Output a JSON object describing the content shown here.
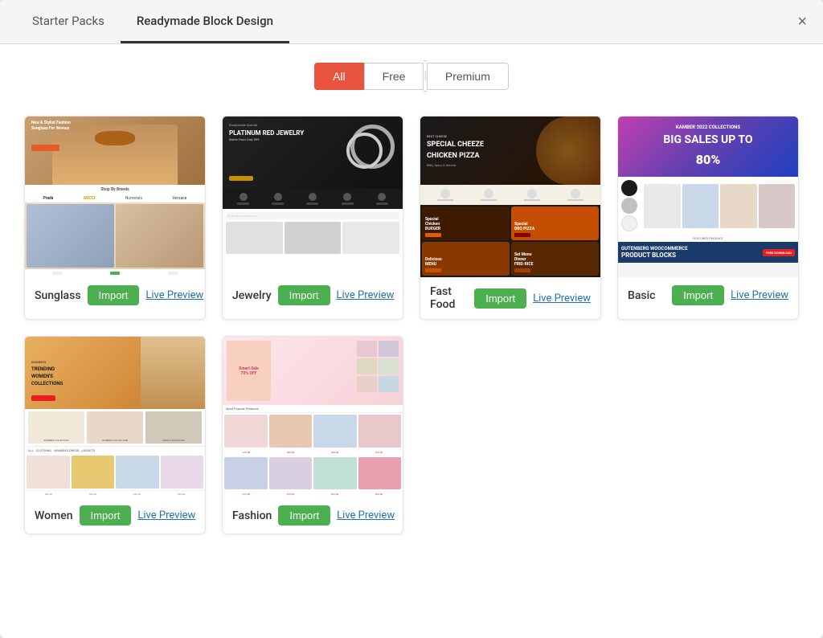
{
  "modal": {
    "title": "Readymade Block Design"
  },
  "tabs": [
    {
      "id": "starter-packs",
      "label": "Starter Packs",
      "active": false
    },
    {
      "id": "readymade-block",
      "label": "Readymade Block Design",
      "active": true
    }
  ],
  "close_button": "×",
  "filter": {
    "all_label": "All",
    "free_label": "Free",
    "premium_label": "Premium",
    "separator": "|"
  },
  "cards": [
    {
      "id": "sunglass",
      "label": "Sunglass",
      "import_label": "Import",
      "preview_label": "Live Preview",
      "type": "sunglass"
    },
    {
      "id": "jewelry",
      "label": "Jewelry",
      "import_label": "Import",
      "preview_label": "Live Preview",
      "type": "jewelry"
    },
    {
      "id": "fastfood",
      "label": "Fast Food",
      "import_label": "Import",
      "preview_label": "Live Preview",
      "type": "fastfood"
    },
    {
      "id": "basic",
      "label": "Basic",
      "import_label": "Import",
      "preview_label": "Live Preview",
      "type": "basic"
    },
    {
      "id": "women",
      "label": "Women",
      "import_label": "Import",
      "preview_label": "Live Preview",
      "type": "women"
    },
    {
      "id": "fashion",
      "label": "Fashion",
      "import_label": "Import",
      "preview_label": "Live Preview",
      "type": "fashion"
    }
  ],
  "colors": {
    "active_tab_underline": "#333333",
    "all_filter_bg": "#e8533f",
    "import_btn": "#4caf50"
  }
}
